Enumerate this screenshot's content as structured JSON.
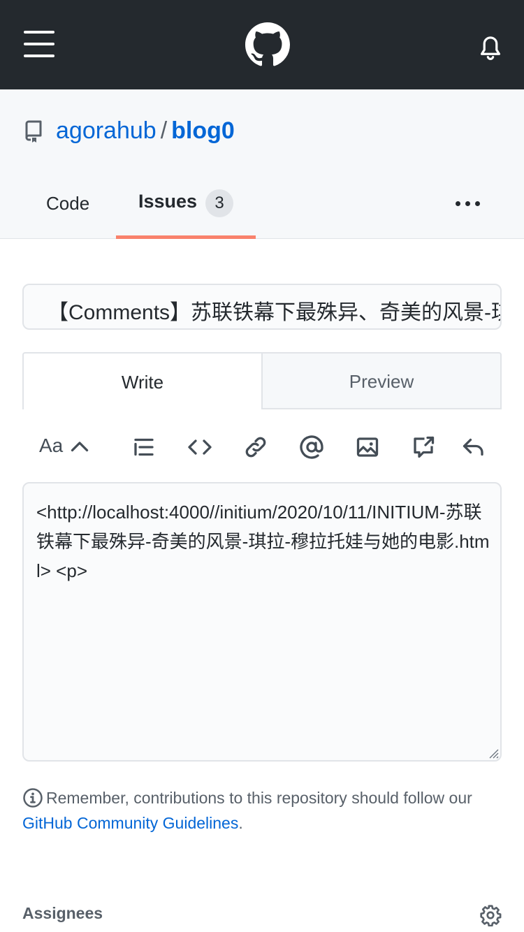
{
  "header": {
    "menu_icon": "hamburger-icon",
    "logo_icon": "github-mark-icon",
    "notifications_icon": "bell-icon"
  },
  "repo": {
    "owner": "agorahub",
    "separator": "/",
    "name": "blog0"
  },
  "nav": {
    "code_label": "Code",
    "issues_label": "Issues",
    "issues_count": "3",
    "more_icon": "kebab-horizontal-icon",
    "active_color": "#f9826c"
  },
  "issue": {
    "title_value": "【Comments】苏联铁幕下最殊异、奇美的风景-琪拉-穆拉托娃与她的电影",
    "tabs": {
      "write_label": "Write",
      "preview_label": "Preview"
    },
    "toolbar": {
      "text_label": "Aa",
      "icons": [
        "chevron-up-icon",
        "list-icon",
        "code-icon",
        "link-icon",
        "mention-icon",
        "image-icon",
        "cross-reference-icon",
        "reply-icon"
      ]
    },
    "body_value": "<http://localhost:4000//initium/2020/10/11/INITIUM-苏联铁幕下最殊异-奇美的风景-琪拉-穆拉托娃与她的电影.html> <p>"
  },
  "notice": {
    "text": "Remember, contributions to this repository should follow our",
    "link_text": "GitHub Community Guidelines",
    "suffix": "."
  },
  "sidebar": {
    "assignees_label": "Assignees"
  },
  "colors": {
    "header_bg": "#24292e",
    "link": "#0366d6",
    "subheader_bg": "#f6f8fa"
  }
}
